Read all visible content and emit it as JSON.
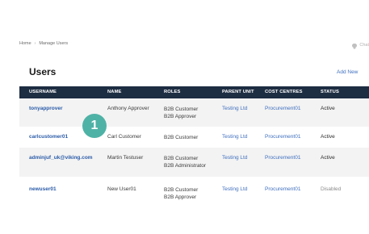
{
  "breadcrumb": {
    "home": "Home",
    "separator": "›",
    "current": "Manage Users"
  },
  "chat": {
    "label": "Chat",
    "icon": "chat-bubble-icon"
  },
  "page": {
    "title": "Users",
    "add_new": "Add New"
  },
  "table": {
    "headers": [
      "USERNAME",
      "NAME",
      "ROLES",
      "PARENT UNIT",
      "COST CENTRES",
      "STATUS"
    ],
    "rows": [
      {
        "username": "tonyapprover",
        "name": "Anthony Approver",
        "roles": [
          "B2B Customer",
          "B2B Approver"
        ],
        "parent_unit": "Testing Ltd",
        "cost_centre": "Procurement01",
        "status": "Active"
      },
      {
        "username": "carlcustomer01",
        "name": "Carl Customer",
        "roles": [
          "B2B Customer",
          ""
        ],
        "parent_unit": "Testing Ltd",
        "cost_centre": "Procurement01",
        "status": "Active"
      },
      {
        "username": "adminjuf_uk@viking.com",
        "name": "Martin Testuser",
        "roles": [
          "B2B Customer",
          "B2B Administrator"
        ],
        "parent_unit": "Testing Ltd",
        "cost_centre": "Procurement01",
        "status": "Active"
      },
      {
        "username": "newuser01",
        "name": "New User01",
        "roles": [
          "B2B Customer",
          "B2B Approver"
        ],
        "parent_unit": "Testing Ltd",
        "cost_centre": "Procurement01",
        "status": "Disabled"
      }
    ]
  },
  "badge": {
    "number": "1",
    "color": "#4fb2a6"
  },
  "colors": {
    "header_bg": "#1d2d42",
    "link": "#3f6fbf",
    "row_alt": "#f3f3f3"
  }
}
